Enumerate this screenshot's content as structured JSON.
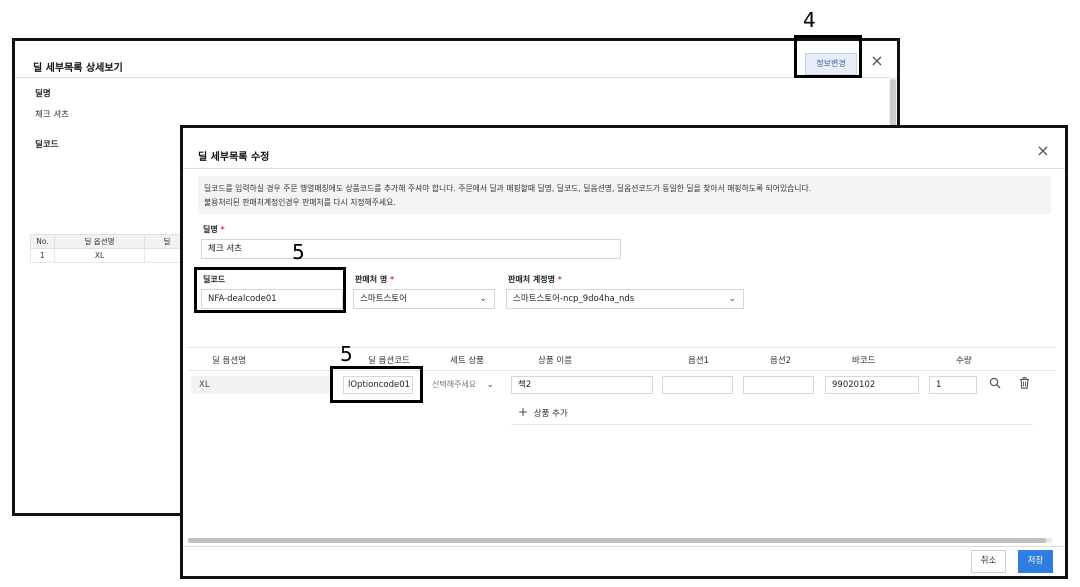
{
  "annotations": {
    "step4": "4",
    "step5a": "5",
    "step5b": "5"
  },
  "back_modal": {
    "title": "딜 세부목록 상세보기",
    "change_info_button": "정보변경",
    "close_icon": "×",
    "deal_name_label": "딜명",
    "deal_name_value": "체크 셔츠",
    "deal_code_label": "딜코드",
    "table": {
      "headers": [
        "No.",
        "딜 옵션명",
        "딜"
      ],
      "rows": [
        [
          "1",
          "XL",
          ""
        ]
      ]
    }
  },
  "front_modal": {
    "title": "딜 세부목록 수정",
    "close_icon": "×",
    "notice_lines": [
      "딜코드를 입력하실 경우 주문 행열매칭에도 상품코드를 추가해 주셔야 합니다. 주문에서 딜과 매핑할때 딜명, 딜코드, 딜옵션명, 딜옵션코드가 동일한 딜을 찾아서 매핑하도록 되어있습니다.",
      "불용처리된 판매처계정인경우 판매처를 다시 지정해주세요."
    ],
    "deal_name": {
      "label": "딜명",
      "required": "*",
      "value": "체크 셔츠"
    },
    "deal_code": {
      "label": "딜코드",
      "value": "NFA-dealcode01"
    },
    "seller": {
      "label": "판매처 명",
      "required": "*",
      "value": "스마트스토어",
      "caret": "⌄"
    },
    "seller_account": {
      "label": "판매처 계정명",
      "required": "*",
      "value": "스마트스토어-ncp_9do4ha_nds",
      "caret": "⌄"
    },
    "option_table": {
      "headers": [
        "딜 옵션명",
        "딜 옵션코드",
        "세트 상품",
        "상품 이름",
        "옵션1",
        "옵션2",
        "바코드",
        "수량"
      ],
      "row": {
        "option_name": "XL",
        "option_code": "lOptioncode01",
        "set_product": "선택해주세요",
        "set_caret": "⌄",
        "product_name": "책2",
        "option1": "",
        "option2": "",
        "barcode": "99020102",
        "quantity": "1"
      },
      "add_product_label": "상품 추가",
      "add_plus": "+"
    },
    "cancel_button": "취소",
    "save_button": "저장"
  },
  "colors": {
    "primary": "#2f7de1",
    "required": "#dd3333",
    "notice_bg": "#f4f4f4"
  }
}
